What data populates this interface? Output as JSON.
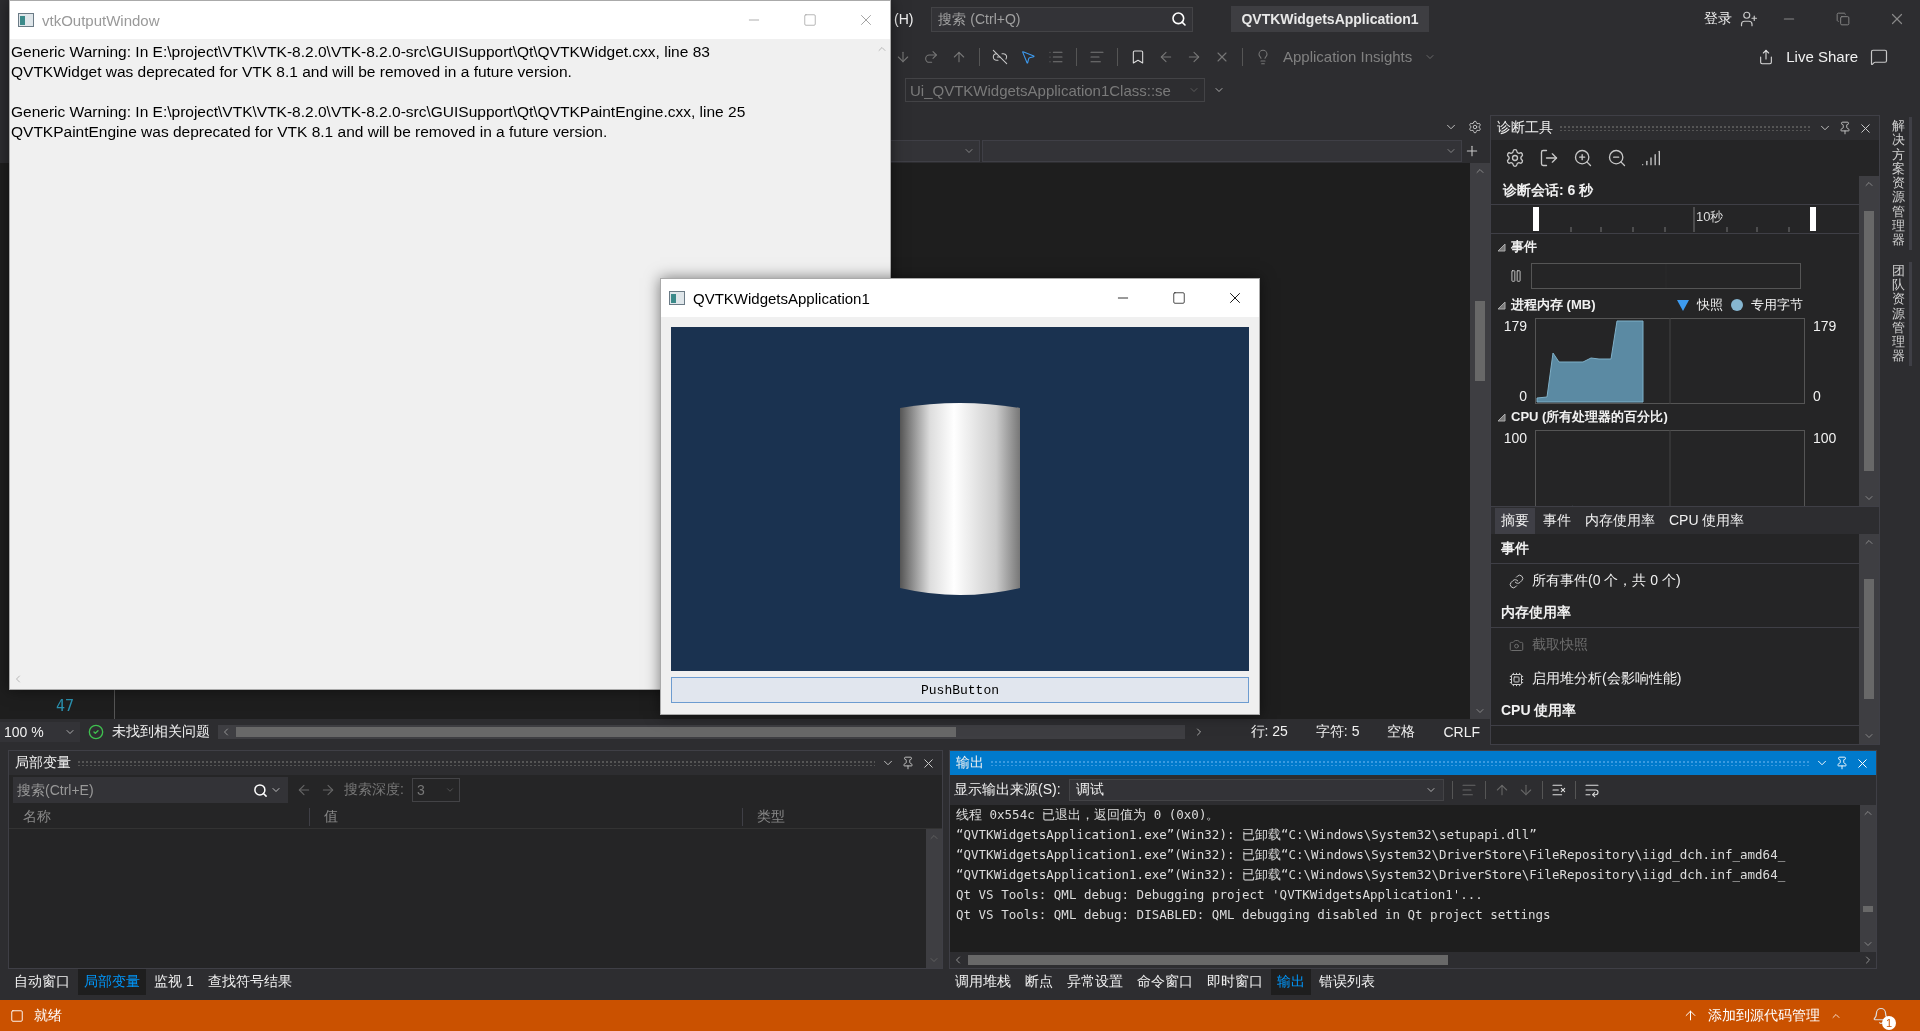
{
  "ide": {
    "menu_item": "(H)",
    "search": {
      "placeholder": "搜索 (Ctrl+Q)"
    },
    "solution_name": "QVTKWidgetsApplication1",
    "sign_in": "登录",
    "toolbar": {
      "insights": "Application Insights",
      "live_share": "Live Share",
      "member_dropdown": "Ui_QVTKWidgetsApplication1Class::se"
    },
    "editor": {
      "line_numbers": [
        "47"
      ],
      "zoom": "100 %",
      "issues": "未找到相关问题",
      "position": [
        "行: 25",
        "字符: 5",
        "空格",
        "CRLF"
      ]
    },
    "diagnostics": {
      "title": "诊断工具",
      "session": "诊断会话: 6 秒",
      "ruler_label": "10秒",
      "sections": [
        {
          "title": "事件",
          "expanded": true,
          "kind": "events"
        },
        {
          "title": "进程内存 (MB)",
          "expanded": true,
          "kind": "memory_chart",
          "legend": [
            {
              "label": "快照",
              "kind": "triangle",
              "color": "#3d9bf0"
            },
            {
              "label": "专用字节",
              "kind": "dot",
              "color": "#86b6d0"
            }
          ],
          "left_ticks": [
            "179",
            "0"
          ],
          "right_ticks": [
            "179",
            "0"
          ]
        },
        {
          "title": "CPU (所有处理器的百分比)",
          "expanded": true,
          "kind": "cpu_chart",
          "left_ticks": [
            "100"
          ],
          "right_ticks": [
            "100"
          ]
        }
      ],
      "tabs": [
        {
          "label": "摘要",
          "selected": true
        },
        {
          "label": "事件",
          "selected": false
        },
        {
          "label": "内存使用率",
          "selected": false
        },
        {
          "label": "CPU 使用率",
          "selected": false
        }
      ],
      "summary": [
        {
          "heading": "事件",
          "items": [
            {
              "label": "所有事件(0 个，共 0 个)",
              "kind": "events",
              "disabled": false
            }
          ]
        },
        {
          "heading": "内存使用率",
          "items": [
            {
              "label": "截取快照",
              "kind": "snapshot",
              "disabled": true
            },
            {
              "label": "启用堆分析(会影响性能)",
              "kind": "heap",
              "disabled": false
            }
          ]
        },
        {
          "heading": "CPU 使用率"
        }
      ]
    },
    "side_tabs": [
      "解决方案资源管理器",
      "团队资源管理器"
    ],
    "locals": {
      "title": "局部变量",
      "search": {
        "placeholder": "搜索(Ctrl+E)"
      },
      "depth_label": "搜索深度:",
      "depth_value": "3",
      "columns": [
        "名称",
        "值",
        "类型"
      ],
      "tabs": [
        {
          "label": "自动窗口",
          "selected": false
        },
        {
          "label": "局部变量",
          "selected": true
        },
        {
          "label": "监视 1",
          "selected": false
        },
        {
          "label": "查找符号结果",
          "selected": false
        }
      ]
    },
    "output": {
      "title": "输出",
      "source_label": "显示输出来源(S):",
      "source_value": "调试",
      "lines": [
        "线程 0x554c 已退出，返回值为 0 (0x0)。",
        "“QVTKWidgetsApplication1.exe”(Win32): 已卸载“C:\\Windows\\System32\\setupapi.dll”",
        "“QVTKWidgetsApplication1.exe”(Win32): 已卸载“C:\\Windows\\System32\\DriverStore\\FileRepository\\iigd_dch.inf_amd64_",
        "“QVTKWidgetsApplication1.exe”(Win32): 已卸载“C:\\Windows\\System32\\DriverStore\\FileRepository\\iigd_dch.inf_amd64_",
        "Qt VS Tools: QML debug: Debugging project 'QVTKWidgetsApplication1'...",
        "Qt VS Tools: QML debug: DISABLED: QML debugging disabled in Qt project settings"
      ],
      "tabs": [
        {
          "label": "调用堆栈",
          "selected": false
        },
        {
          "label": "断点",
          "selected": false
        },
        {
          "label": "异常设置",
          "selected": false
        },
        {
          "label": "命令窗口",
          "selected": false
        },
        {
          "label": "即时窗口",
          "selected": false
        },
        {
          "label": "输出",
          "selected": true
        },
        {
          "label": "错误列表",
          "selected": false
        }
      ]
    },
    "status_bar": {
      "text": "就绪",
      "source_control": "添加到源代码管理",
      "notifications": "1"
    }
  },
  "vtk_output_window": {
    "title": "vtkOutputWindow",
    "active": false,
    "messages": [
      {
        "lines": [
          "Generic Warning: In E:\\project\\VTK\\VTK-8.2.0\\VTK-8.2.0-src\\GUISupport\\Qt\\QVTKWidget.cxx, line 83",
          "QVTKWidget was deprecated for VTK 8.1 and will be removed in a future version."
        ]
      },
      {
        "lines": [
          "Generic Warning: In E:\\project\\VTK\\VTK-8.2.0\\VTK-8.2.0-src\\GUISupport\\Qt\\QVTKPaintEngine.cxx, line 25",
          "QVTKPaintEngine was deprecated for VTK 8.1 and will be removed in a future version."
        ]
      }
    ]
  },
  "app_window": {
    "title": "QVTKWidgetsApplication1",
    "active": true,
    "button": "PushButton"
  }
}
